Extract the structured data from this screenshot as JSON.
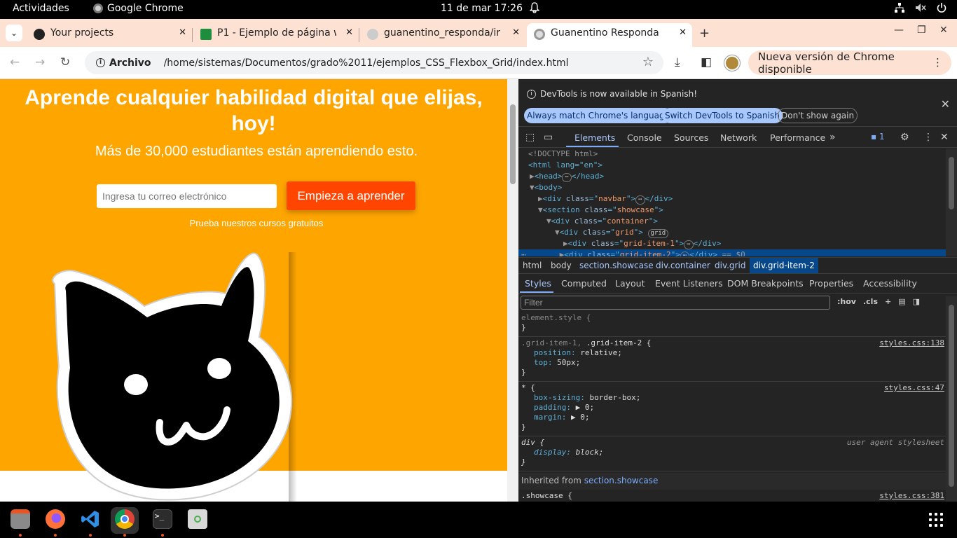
{
  "system": {
    "activities": "Actividades",
    "app_name": "Google Chrome",
    "clock": "11 de mar  17:26"
  },
  "tabs": [
    {
      "title": "Your projects",
      "active": false
    },
    {
      "title": "P1 - Ejemplo de página w",
      "active": false
    },
    {
      "title": "guanentino_responda/ir",
      "active": false
    },
    {
      "title": "Guanentino Responda",
      "active": true
    }
  ],
  "omnibox": {
    "chip": "Archivo",
    "url": "/home/sistemas/Documentos/grado%2011/ejemplos_CSS_Flexbox_Grid/index.html"
  },
  "update_chip": "Nueva versión de Chrome disponible",
  "page": {
    "hero_title": "Aprende cualquier habilidad digital que elijas, hoy!",
    "hero_subtitle": "Más de 30,000 estudiantes están aprendiendo esto.",
    "email_placeholder": "Ingresa tu correo electrónico",
    "cta": "Empieza a aprender",
    "free_courses": "Prueba nuestros cursos gratuitos",
    "colors": {
      "showcase_bg": "#ffa500",
      "cta_bg": "#ff4500"
    }
  },
  "devtools": {
    "banner": {
      "message": "DevTools is now available in Spanish!",
      "btn_match": "Always match Chrome's language",
      "btn_switch": "Switch DevTools to Spanish",
      "btn_dismiss": "Don't show again"
    },
    "tabs": [
      "Elements",
      "Console",
      "Sources",
      "Network",
      "Performance"
    ],
    "issues_count": "1",
    "dom": {
      "doctype": "<!DOCTYPE html>",
      "html_open": "<html lang=\"en\">",
      "head": "<head>",
      "head_close": "</head>",
      "body": "<body>",
      "navbar_class": "navbar",
      "showcase_class": "showcase",
      "container_class": "container",
      "grid_class": "grid",
      "grid_badge": "grid",
      "item1_class": "grid-item-1",
      "item2_class": "grid-item-2",
      "selected_suffix": "== $0"
    },
    "breadcrumbs": [
      "html",
      "body",
      "section.showcase",
      "div.container",
      "div.grid",
      "div.grid-item-2"
    ],
    "sub_tabs": [
      "Styles",
      "Computed",
      "Layout",
      "Event Listeners",
      "DOM Breakpoints",
      "Properties",
      "Accessibility"
    ],
    "filter_placeholder": "Filter",
    "hov": ":hov",
    "cls": ".cls",
    "rules": {
      "element_style": "element.style {",
      "grid_sel_dim": ".grid-item-1,",
      "grid_sel": ".grid-item-2 {",
      "grid_src": "styles.css:138",
      "grid_p1_name": "position",
      "grid_p1_val": "relative;",
      "grid_p2_name": "top",
      "grid_p2_val": "50px;",
      "star_sel": "* {",
      "star_src": "styles.css:47",
      "star_p1_name": "box-sizing",
      "star_p1_val": "border-box;",
      "star_p2_name": "padding",
      "star_p2_val": "0;",
      "star_p3_name": "margin",
      "star_p3_val": "0;",
      "div_sel": "div {",
      "div_src": "user agent stylesheet",
      "div_p1_name": "display",
      "div_p1_val": "block;",
      "inherited_label": "Inherited from",
      "inherited_from": "section.showcase",
      "showcase_sel": ".showcase {",
      "showcase_src": "styles.css:381",
      "close_brace": "}"
    }
  }
}
